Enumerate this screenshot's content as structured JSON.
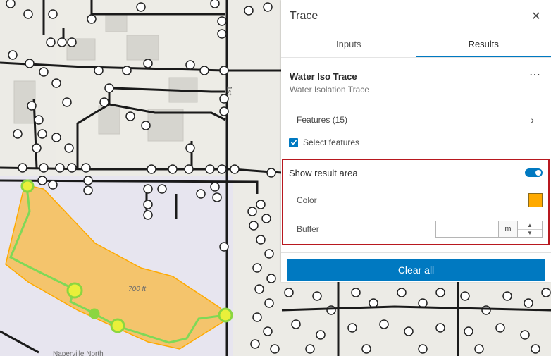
{
  "panel": {
    "title": "Trace",
    "close_icon": "close-icon",
    "tabs": [
      {
        "label": "Inputs",
        "active": false
      },
      {
        "label": "Results",
        "active": true
      }
    ],
    "trace": {
      "name": "Water Iso Trace",
      "type": "Water Isolation Trace",
      "more_icon": "more-options-icon"
    },
    "features": {
      "label": "Features (15)",
      "chevron_icon": "chevron-right-icon"
    },
    "select_features": {
      "label": "Select features",
      "checked": true
    },
    "result_area": {
      "label": "Show result area",
      "enabled": true,
      "color_label": "Color",
      "color": "#ffaa00",
      "buffer_label": "Buffer",
      "buffer_value": "",
      "buffer_unit": "m"
    },
    "clear_label": "Clear all"
  },
  "map": {
    "elevation_label": "700 ft",
    "street_label": "1st",
    "place_label": "Naperville North",
    "polygon_color": "#ffaa00",
    "trace_color": "#7ed957"
  },
  "colors": {
    "accent": "#0079c1",
    "highlight_border": "#b8181f"
  }
}
